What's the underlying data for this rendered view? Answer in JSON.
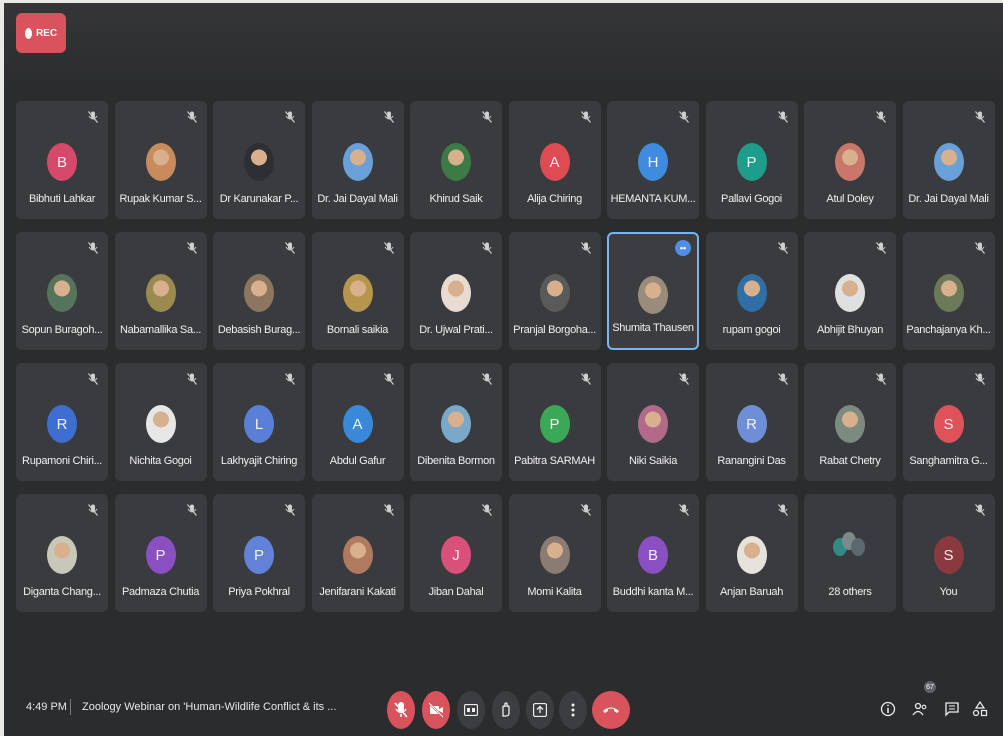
{
  "recording": {
    "label": "REC"
  },
  "participants": [
    {
      "name": "Bibhuti Lahkar",
      "avatar": "B",
      "color": "#d6496a",
      "photo": false,
      "muted": true
    },
    {
      "name": "Rupak Kumar S...",
      "avatar": "",
      "color": "#c98a5c",
      "photo": true,
      "muted": true
    },
    {
      "name": "Dr Karunakar P...",
      "avatar": "",
      "color": "#2e2f33",
      "photo": true,
      "muted": true
    },
    {
      "name": "Dr. Jai Dayal Mali",
      "avatar": "",
      "color": "#6aa0d8",
      "photo": true,
      "muted": true
    },
    {
      "name": "Khirud Saik",
      "avatar": "",
      "color": "#3d7a46",
      "photo": true,
      "muted": true
    },
    {
      "name": "Alija Chiring",
      "avatar": "A",
      "color": "#de4b52",
      "photo": false,
      "muted": true
    },
    {
      "name": "HEMANTA KUM...",
      "avatar": "H",
      "color": "#3e8be0",
      "photo": false,
      "muted": true
    },
    {
      "name": "Pallavi Gogoi",
      "avatar": "P",
      "color": "#1e9e8a",
      "photo": false,
      "muted": true
    },
    {
      "name": "Atul Doley",
      "avatar": "",
      "color": "#c9776a",
      "photo": true,
      "muted": true
    },
    {
      "name": "Dr. Jai Dayal Mali",
      "avatar": "",
      "color": "#6aa0d8",
      "photo": true,
      "muted": true
    },
    {
      "name": "Sopun Buragoh...",
      "avatar": "",
      "color": "#56745c",
      "photo": true,
      "muted": true
    },
    {
      "name": "Nabamallika Sa...",
      "avatar": "",
      "color": "#9a8a4e",
      "photo": true,
      "muted": true
    },
    {
      "name": "Debasish Burag...",
      "avatar": "",
      "color": "#8c7660",
      "photo": true,
      "muted": true
    },
    {
      "name": "Bornali saikia",
      "avatar": "",
      "color": "#b5964c",
      "photo": true,
      "muted": true
    },
    {
      "name": "Dr. Ujwal Prati...",
      "avatar": "",
      "color": "#e8dcd0",
      "photo": true,
      "muted": true
    },
    {
      "name": "Pranjal Borgoha...",
      "avatar": "",
      "color": "#5a5a5a",
      "photo": true,
      "muted": true
    },
    {
      "name": "Shumita Thausen",
      "avatar": "",
      "color": "#9a8c7c",
      "photo": true,
      "muted": false,
      "speaking": true
    },
    {
      "name": "rupam gogoi",
      "avatar": "",
      "color": "#2f6fa6",
      "photo": true,
      "muted": true
    },
    {
      "name": "Abhijit Bhuyan",
      "avatar": "",
      "color": "#e0e0e0",
      "photo": true,
      "muted": true
    },
    {
      "name": "Panchajanya Kh...",
      "avatar": "",
      "color": "#6d7a5a",
      "photo": true,
      "muted": true
    },
    {
      "name": "Rupamoni Chiri...",
      "avatar": "R",
      "color": "#3e6fd0",
      "photo": false,
      "muted": true
    },
    {
      "name": "Nichita Gogoi",
      "avatar": "",
      "color": "#e6e6e6",
      "photo": true,
      "muted": true
    },
    {
      "name": "Lakhyajit Chiring",
      "avatar": "L",
      "color": "#5a7fd6",
      "photo": false,
      "muted": true
    },
    {
      "name": "Abdul Gafur",
      "avatar": "A",
      "color": "#3a88d8",
      "photo": false,
      "muted": true
    },
    {
      "name": "Dibenita Bormon",
      "avatar": "",
      "color": "#7aa8c8",
      "photo": true,
      "muted": true
    },
    {
      "name": "Pabitra SARMAH",
      "avatar": "P",
      "color": "#3aa856",
      "photo": false,
      "muted": true
    },
    {
      "name": "Niki Saikia",
      "avatar": "",
      "color": "#b36a8a",
      "photo": true,
      "muted": true
    },
    {
      "name": "Ranangini Das",
      "avatar": "R",
      "color": "#6e8fd6",
      "photo": false,
      "muted": true
    },
    {
      "name": "Rabat Chetry",
      "avatar": "",
      "color": "#7c8a80",
      "photo": true,
      "muted": true
    },
    {
      "name": "Sanghamitra G...",
      "avatar": "S",
      "color": "#e0525a",
      "photo": false,
      "muted": true
    },
    {
      "name": "Diganta Chang...",
      "avatar": "",
      "color": "#c8c8b8",
      "photo": true,
      "muted": true
    },
    {
      "name": "Padmaza Chutia",
      "avatar": "P",
      "color": "#8a4fc0",
      "photo": false,
      "muted": true
    },
    {
      "name": "Priya Pokhral",
      "avatar": "P",
      "color": "#6282d8",
      "photo": false,
      "muted": true
    },
    {
      "name": "Jenifarani Kakati",
      "avatar": "",
      "color": "#b07a5e",
      "photo": true,
      "muted": true
    },
    {
      "name": "Jiban Dahal",
      "avatar": "J",
      "color": "#d9507a",
      "photo": false,
      "muted": true
    },
    {
      "name": "Momi Kalita",
      "avatar": "",
      "color": "#8a7c72",
      "photo": true,
      "muted": true
    },
    {
      "name": "Buddhi kanta M...",
      "avatar": "B",
      "color": "#8a4fc0",
      "photo": false,
      "muted": true
    },
    {
      "name": "Anjan Baruah",
      "avatar": "",
      "color": "#e6e2dc",
      "photo": true,
      "muted": true
    },
    {
      "name": "28 others",
      "avatar": "",
      "color": "#3a3b3e",
      "photo": false,
      "muted": false,
      "group": true
    },
    {
      "name": "You",
      "avatar": "S",
      "color": "#8a3a3e",
      "photo": false,
      "muted": true
    }
  ],
  "bottom_bar": {
    "time": "4:49 PM",
    "meeting_title": "Zoology Webinar on 'Human-Wildlife Conflict & its ...",
    "participant_count": "67",
    "controls": {
      "mic": "mic-off-icon",
      "camera": "camera-off-icon",
      "captions": "captions-icon",
      "raise_hand": "raise-hand-icon",
      "present": "present-icon",
      "more": "more-options-icon",
      "end_call": "end-call-icon"
    },
    "right_icons": [
      "info-icon",
      "people-icon",
      "chat-icon",
      "activities-icon"
    ]
  },
  "colors": {
    "background": "#2b2c2e",
    "tile": "#3a3b3e",
    "danger": "#d8535b",
    "active_border": "#7ab4ef"
  }
}
